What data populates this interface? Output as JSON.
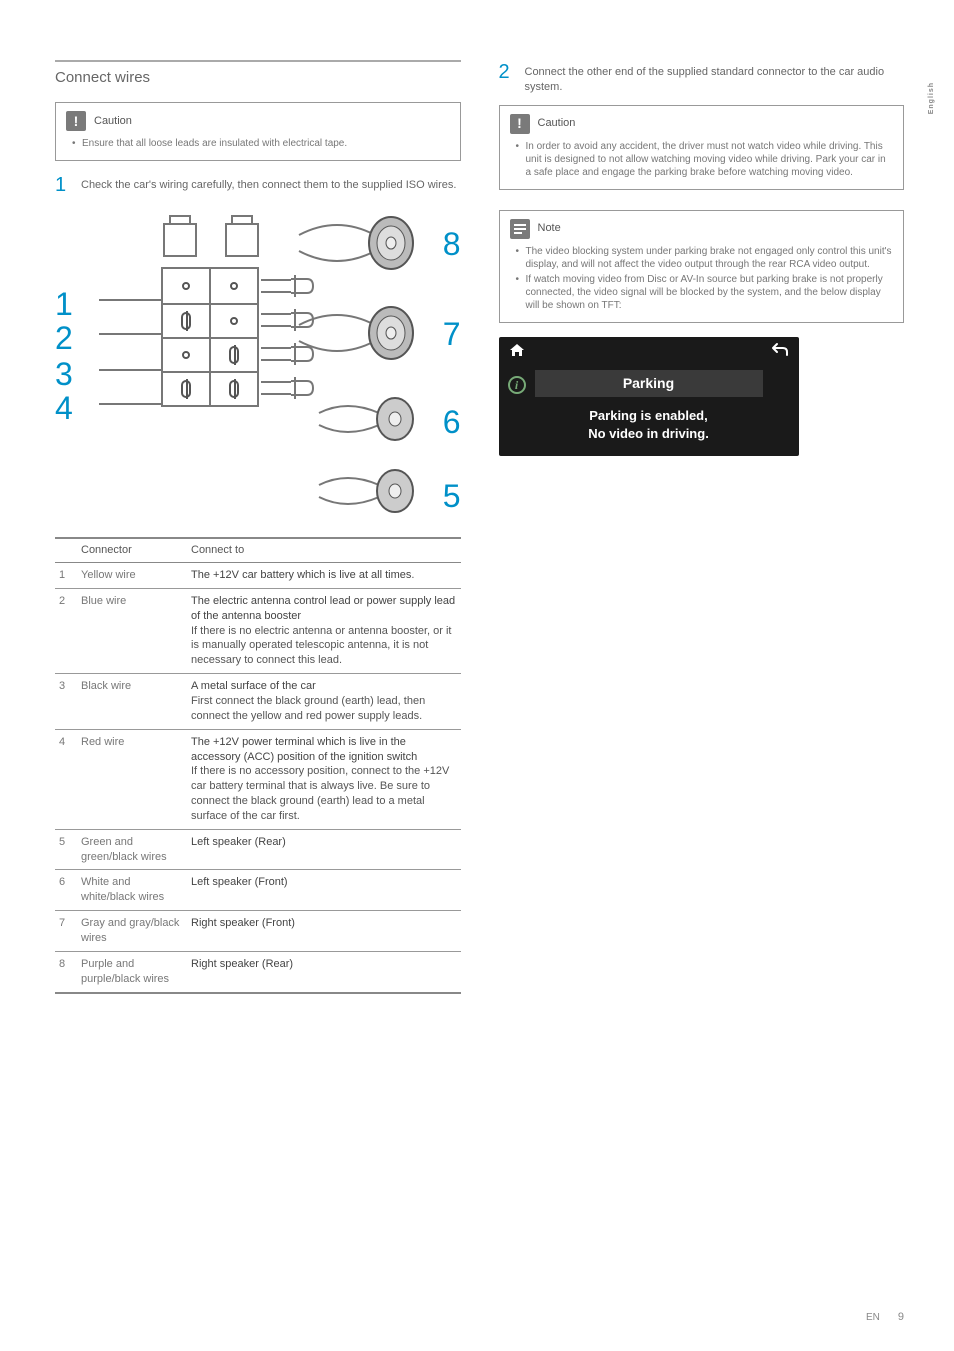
{
  "sideTab": "English",
  "footer": {
    "lang": "EN",
    "page": "9"
  },
  "left": {
    "sectionTitle": "Connect wires",
    "caution": {
      "title": "Caution",
      "items": [
        "Ensure that all loose leads are insulated with electrical tape."
      ]
    },
    "step1": {
      "num": "1",
      "text": "Check the car's wiring carefully, then connect them to the supplied ISO wires."
    },
    "diagramNums": {
      "n1": "1",
      "n2": "2",
      "n3": "3",
      "n4": "4",
      "n5": "5",
      "n6": "6",
      "n7": "7",
      "n8": "8"
    },
    "table": {
      "headers": {
        "blank": "",
        "connector": "Connector",
        "connectTo": "Connect to"
      },
      "rows": [
        {
          "n": "1",
          "name": "Yellow wire",
          "lead": "The +12V car battery which is live at all times",
          "rest": "."
        },
        {
          "n": "2",
          "name": "Blue wire",
          "lead": "The electric antenna control lead or power supply lead of the antenna booster",
          "rest": "If there is no electric antenna or antenna booster, or it is manually operated telescopic antenna, it is not necessary to connect this lead."
        },
        {
          "n": "3",
          "name": "Black wire",
          "lead": "A metal surface of the car",
          "rest": "First connect the black ground (earth) lead, then connect the yellow and red power supply leads."
        },
        {
          "n": "4",
          "name": "Red wire",
          "lead": "The +12V power terminal which is live in the accessory (ACC) position of the ignition switch",
          "rest": "If there is no accessory position, connect to the +12V car battery terminal that is always live. Be sure to connect the black ground (earth) lead to a metal surface of the car first."
        },
        {
          "n": "5",
          "name": "Green and green/black wires",
          "lead": "Left speaker (Rear)",
          "rest": ""
        },
        {
          "n": "6",
          "name": "White and white/black wires",
          "lead": "Left speaker (Front)",
          "rest": ""
        },
        {
          "n": "7",
          "name": "Gray and gray/black wires",
          "lead": "Right speaker (Front)",
          "rest": ""
        },
        {
          "n": "8",
          "name": "Purple and purple/black wires",
          "lead": "Right speaker (Rear)",
          "rest": ""
        }
      ]
    }
  },
  "right": {
    "step2": {
      "num": "2",
      "text": "Connect the other end of the supplied standard connector to the car audio system."
    },
    "caution": {
      "title": "Caution",
      "items": [
        "In order to avoid any accident, the driver must not watch video while driving. This unit is designed to not allow watching moving video while driving. Park your car in a safe place and engage the parking brake before watching moving video."
      ]
    },
    "note": {
      "title": "Note",
      "items": [
        "The video blocking system under parking brake not engaged only control this unit's display, and will not affect the video output through the rear RCA video output.",
        "If watch moving video from Disc or AV-In source but parking brake is not properly connected, the video signal will be blocked by the system, and the below display will be shown on TFT:"
      ]
    },
    "tft": {
      "homeIcon": "⌂",
      "backIcon": "↶",
      "title": "Parking",
      "line1": "Parking is enabled,",
      "line2": "No video in driving."
    }
  }
}
